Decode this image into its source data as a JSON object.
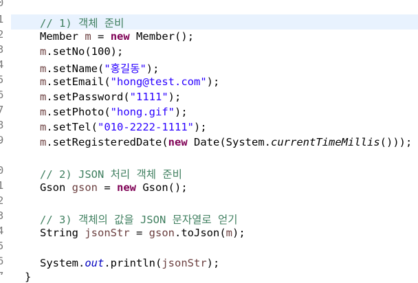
{
  "editor": {
    "line_numbers": [
      "0",
      "1",
      "2",
      "3",
      "4",
      "5",
      "6",
      "7",
      "8",
      "9",
      "0",
      "1",
      "2",
      "3",
      "4",
      "5",
      "6",
      "7"
    ],
    "comments": {
      "c1": "// 1) 객체 준비",
      "c2": "// 2) JSON 처리 객체 준비",
      "c3": "// 3) 객체의 값을 JSON 문자열로 얻기"
    },
    "keywords": {
      "new": "new"
    },
    "types": {
      "member": "Member",
      "date": "Date",
      "system": "System",
      "gson": "Gson",
      "string": "String"
    },
    "vars": {
      "m": "m",
      "gson": "gson",
      "jsonStr": "jsonStr"
    },
    "methods": {
      "setNo": ".setNo(",
      "setName": ".setName(",
      "setEmail": ".setEmail(",
      "setPassword": ".setPassword(",
      "setPhoto": ".setPhoto(",
      "setTel": ".setTel(",
      "setRegisteredDate": ".setRegisteredDate(",
      "currentTimeMillis": "currentTimeMillis",
      "toJson": ".toJson(",
      "println": ".println("
    },
    "fields": {
      "out": "out"
    },
    "strings": {
      "name": "\"홍길동\"",
      "email": "\"hong@test.com\"",
      "password": "\"1111\"",
      "photo": "\"hong.gif\"",
      "tel": "\"010-2222-1111\""
    },
    "literals": {
      "no": "100"
    },
    "caret_line": "1",
    "closing_brace": "}"
  },
  "colors": {
    "comment": "#3f7f5f",
    "keyword": "#7f0055",
    "string": "#2a00ff",
    "local_variable": "#6a3e3e",
    "static_field": "#0000c0",
    "current_line_highlight": "#e8f2fe",
    "line_number": "#787878"
  }
}
